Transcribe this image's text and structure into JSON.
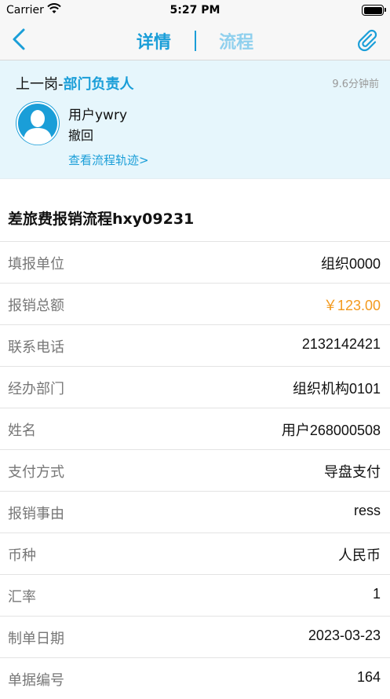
{
  "status": {
    "carrier": "Carrier",
    "time": "5:27 PM"
  },
  "nav": {
    "tab_detail": "详情",
    "tab_flow": "流程",
    "icons": {
      "back": "chevron-left-icon",
      "attach": "paperclip-icon"
    },
    "colors": {
      "active": "#1a9ed8",
      "inactive": "#8fd0ee"
    }
  },
  "flow": {
    "step_prefix": "上一岗-",
    "step_role": "部门负责人",
    "time_ago": "9.6分钟前",
    "user": "用户ywry",
    "action": "撤回",
    "trace_link": "查看流程轨迹>",
    "bg_color": "#e6f6fc"
  },
  "form": {
    "title": "差旅费报销流程hxy09231",
    "rows": [
      {
        "label": "填报单位",
        "value": "组织0000"
      },
      {
        "label": "报销总额",
        "value": "￥123.00"
      },
      {
        "label": "联系电话",
        "value": "2132142421"
      },
      {
        "label": "经办部门",
        "value": "组织机构0101"
      },
      {
        "label": "姓名",
        "value": "用户268000508"
      },
      {
        "label": "支付方式",
        "value": "导盘支付"
      },
      {
        "label": "报销事由",
        "value": "ress"
      },
      {
        "label": "币种",
        "value": "人民币"
      },
      {
        "label": "汇率",
        "value": "1"
      },
      {
        "label": "制单日期",
        "value": "2023-03-23"
      },
      {
        "label": "单据编号",
        "value": "164"
      }
    ],
    "money_color": "#f39a1e"
  }
}
